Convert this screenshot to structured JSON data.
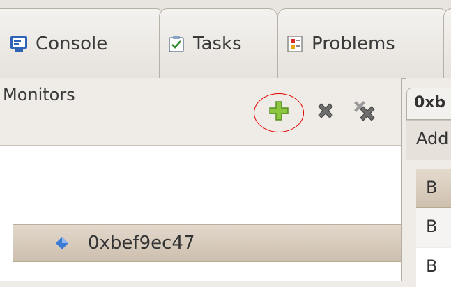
{
  "tabs": [
    {
      "label": "Console",
      "icon": "console-icon"
    },
    {
      "label": "Tasks",
      "icon": "tasks-icon"
    },
    {
      "label": "Problems",
      "icon": "problems-icon"
    }
  ],
  "monitors": {
    "title": "Monitors",
    "toolbar": {
      "add_icon": "add-monitor-icon",
      "remove_icon": "remove-monitor-icon",
      "remove_all_icon": "remove-all-monitors-icon",
      "highlight_color": "#e00000"
    },
    "items": [
      {
        "label": "0xbef9ec47",
        "icon": "memory-monitor-diamond-icon"
      }
    ]
  },
  "rendering": {
    "tab_label": "0xb",
    "header": "Add",
    "rows": [
      "B",
      "B",
      "B"
    ]
  },
  "colors": {
    "selection": "#d6cabb",
    "add_green": "#8cc63f",
    "diamond_blue": "#3a7bd5"
  }
}
